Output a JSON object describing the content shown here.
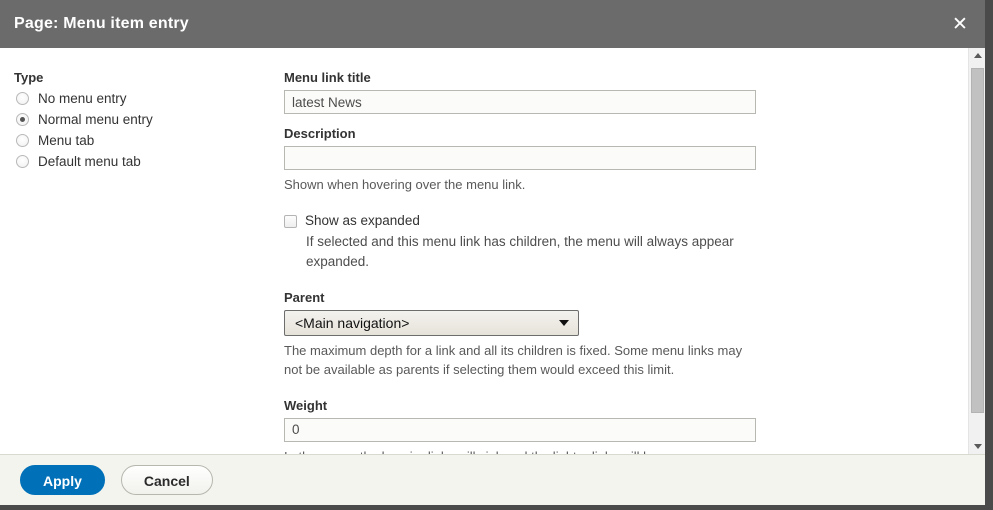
{
  "dialog": {
    "title": "Page: Menu item entry",
    "close_icon": "close-icon"
  },
  "type_section": {
    "label": "Type",
    "options": [
      {
        "label": "No menu entry",
        "selected": false
      },
      {
        "label": "Normal menu entry",
        "selected": true
      },
      {
        "label": "Menu tab",
        "selected": false
      },
      {
        "label": "Default menu tab",
        "selected": false
      }
    ]
  },
  "form": {
    "menu_link_title": {
      "label": "Menu link title",
      "value": "latest News",
      "placeholder": ""
    },
    "description": {
      "label": "Description",
      "value": "",
      "placeholder": "",
      "help": "Shown when hovering over the menu link."
    },
    "show_expanded": {
      "label": "Show as expanded",
      "checked": false,
      "help": "If selected and this menu link has children, the menu will always appear expanded."
    },
    "parent": {
      "label": "Parent",
      "value": "<Main navigation>",
      "help": "The maximum depth for a link and all its children is fixed. Some menu links may not be available as parents if selecting them would exceed this limit."
    },
    "weight": {
      "label": "Weight",
      "value": "0",
      "placeholder": "",
      "help": "In the menu, the heavier links will sink and the lighter links will be"
    }
  },
  "footer": {
    "apply_label": "Apply",
    "cancel_label": "Cancel"
  },
  "scrollbar": {
    "up_icon": "chevron-up-icon",
    "down_icon": "chevron-down-icon"
  },
  "colors": {
    "header_bg": "#6b6b6b",
    "primary": "#0071b8",
    "page_bg": "#4a4a4a"
  }
}
